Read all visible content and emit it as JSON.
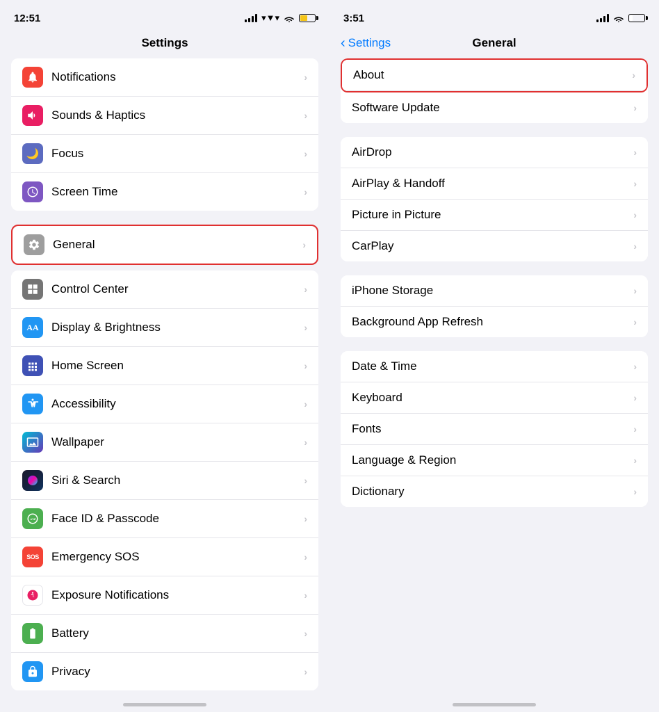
{
  "left_panel": {
    "status": {
      "time": "12:51",
      "moon": "🌙"
    },
    "title": "Settings",
    "group1": {
      "items": [
        {
          "id": "notifications",
          "label": "Notifications",
          "icon_bg": "#f44336",
          "icon": "🔔"
        },
        {
          "id": "sounds",
          "label": "Sounds & Haptics",
          "icon_bg": "#e91e63",
          "icon": "🔈"
        },
        {
          "id": "focus",
          "label": "Focus",
          "icon_bg": "#5c6bc0",
          "icon": "🌙"
        },
        {
          "id": "screentime",
          "label": "Screen Time",
          "icon_bg": "#7e57c2",
          "icon": "⏱"
        }
      ]
    },
    "group2": {
      "items": [
        {
          "id": "general",
          "label": "General",
          "icon_bg": "#9e9e9e",
          "icon": "⚙️",
          "highlighted": true
        }
      ]
    },
    "group3": {
      "items": [
        {
          "id": "controlcenter",
          "label": "Control Center",
          "icon_bg": "#757575",
          "icon": "⊞"
        },
        {
          "id": "display",
          "label": "Display & Brightness",
          "icon_bg": "#2196f3",
          "icon": "AA"
        },
        {
          "id": "homescreen",
          "label": "Home Screen",
          "icon_bg": "#3f51b5",
          "icon": "⊞"
        },
        {
          "id": "accessibility",
          "label": "Accessibility",
          "icon_bg": "#2196f3",
          "icon": "♿"
        },
        {
          "id": "wallpaper",
          "label": "Wallpaper",
          "icon_bg": "#00bcd4",
          "icon": "✦"
        },
        {
          "id": "siri",
          "label": "Siri & Search",
          "icon_bg": "#222",
          "icon": "◉"
        },
        {
          "id": "faceid",
          "label": "Face ID & Passcode",
          "icon_bg": "#4caf50",
          "icon": "☺"
        },
        {
          "id": "emergencysos",
          "label": "Emergency SOS",
          "icon_bg": "#f44336",
          "icon": "SOS"
        },
        {
          "id": "exposurenotif",
          "label": "Exposure Notifications",
          "icon_bg": "#fff",
          "icon": "✳",
          "icon_color": "#f44336"
        },
        {
          "id": "battery",
          "label": "Battery",
          "icon_bg": "#4caf50",
          "icon": "🔋"
        },
        {
          "id": "privacy",
          "label": "Privacy",
          "icon_bg": "#2196f3",
          "icon": "✋"
        }
      ]
    }
  },
  "right_panel": {
    "status": {
      "time": "3:51",
      "moon": "🌙"
    },
    "nav_back": "Settings",
    "nav_title": "General",
    "group1": {
      "items": [
        {
          "id": "about",
          "label": "About",
          "highlighted": true
        },
        {
          "id": "softwareupdate",
          "label": "Software Update"
        }
      ]
    },
    "group2": {
      "items": [
        {
          "id": "airdrop",
          "label": "AirDrop"
        },
        {
          "id": "airplay",
          "label": "AirPlay & Handoff"
        },
        {
          "id": "pictureinpicture",
          "label": "Picture in Picture"
        },
        {
          "id": "carplay",
          "label": "CarPlay"
        }
      ]
    },
    "group3": {
      "items": [
        {
          "id": "iphonestorage",
          "label": "iPhone Storage"
        },
        {
          "id": "backgroundapprefresh",
          "label": "Background App Refresh"
        }
      ]
    },
    "group4": {
      "items": [
        {
          "id": "datetime",
          "label": "Date & Time"
        },
        {
          "id": "keyboard",
          "label": "Keyboard"
        },
        {
          "id": "fonts",
          "label": "Fonts"
        },
        {
          "id": "language",
          "label": "Language & Region"
        },
        {
          "id": "dictionary",
          "label": "Dictionary"
        }
      ]
    }
  }
}
